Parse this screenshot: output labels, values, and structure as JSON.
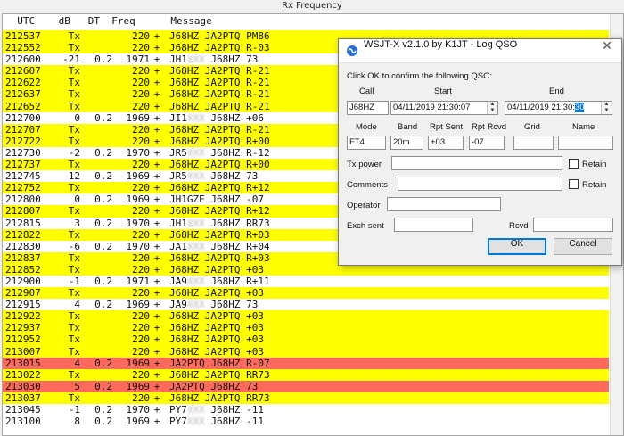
{
  "window": {
    "title": "Rx Frequency"
  },
  "columns": {
    "header": "  UTC    dB   DT  Freq      Message"
  },
  "rows": [
    {
      "utc": "212537",
      "db": "Tx",
      "dt": "",
      "freq": "220",
      "pl": "+",
      "msg": "J68HZ JA2PTQ PM86",
      "style": "tx"
    },
    {
      "utc": "212552",
      "db": "Tx",
      "dt": "",
      "freq": "220",
      "pl": "+",
      "msg": "J68HZ JA2PTQ R-03",
      "style": "tx"
    },
    {
      "utc": "212600",
      "db": "-21",
      "dt": "0.2",
      "freq": "1971",
      "pl": "+",
      "msg_pre": "JH1",
      "msg_blur": "XXX",
      "msg_post": " J68HZ 73",
      "style": ""
    },
    {
      "utc": "212607",
      "db": "Tx",
      "dt": "",
      "freq": "220",
      "pl": "+",
      "msg": "J68HZ JA2PTQ R-21",
      "style": "tx"
    },
    {
      "utc": "212622",
      "db": "Tx",
      "dt": "",
      "freq": "220",
      "pl": "+",
      "msg": "J68HZ JA2PTQ R-21",
      "style": "tx"
    },
    {
      "utc": "212637",
      "db": "Tx",
      "dt": "",
      "freq": "220",
      "pl": "+",
      "msg": "J68HZ JA2PTQ R-21",
      "style": "tx"
    },
    {
      "utc": "212652",
      "db": "Tx",
      "dt": "",
      "freq": "220",
      "pl": "+",
      "msg": "J68HZ JA2PTQ R-21",
      "style": "tx"
    },
    {
      "utc": "212700",
      "db": "0",
      "dt": "0.2",
      "freq": "1969",
      "pl": "+",
      "msg_pre": "JI1",
      "msg_blur": "XXX",
      "msg_post": " J68HZ +06",
      "style": ""
    },
    {
      "utc": "212707",
      "db": "Tx",
      "dt": "",
      "freq": "220",
      "pl": "+",
      "msg": "J68HZ JA2PTQ R-21",
      "style": "tx"
    },
    {
      "utc": "212722",
      "db": "Tx",
      "dt": "",
      "freq": "220",
      "pl": "+",
      "msg": "J68HZ JA2PTQ R+00",
      "style": "tx"
    },
    {
      "utc": "212730",
      "db": "-2",
      "dt": "0.2",
      "freq": "1970",
      "pl": "+",
      "msg_pre": "JR5",
      "msg_blur": "XXX",
      "msg_post": " J68HZ R-12",
      "style": ""
    },
    {
      "utc": "212737",
      "db": "Tx",
      "dt": "",
      "freq": "220",
      "pl": "+",
      "msg": "J68HZ JA2PTQ R+00",
      "style": "tx"
    },
    {
      "utc": "212745",
      "db": "12",
      "dt": "0.2",
      "freq": "1969",
      "pl": "+",
      "msg_pre": "JR5",
      "msg_blur": "XXX",
      "msg_post": " J68HZ 73",
      "style": ""
    },
    {
      "utc": "212752",
      "db": "Tx",
      "dt": "",
      "freq": "220",
      "pl": "+",
      "msg": "J68HZ JA2PTQ R+12",
      "style": "tx"
    },
    {
      "utc": "212800",
      "db": "0",
      "dt": "0.2",
      "freq": "1969",
      "pl": "+",
      "msg": "JH1GZE J68HZ -07",
      "style": ""
    },
    {
      "utc": "212807",
      "db": "Tx",
      "dt": "",
      "freq": "220",
      "pl": "+",
      "msg": "J68HZ JA2PTQ R+12",
      "style": "tx"
    },
    {
      "utc": "212815",
      "db": "3",
      "dt": "0.2",
      "freq": "1970",
      "pl": "+",
      "msg_pre": "JH1",
      "msg_blur": "XXX",
      "msg_post": " J68HZ RR73",
      "style": ""
    },
    {
      "utc": "212822",
      "db": "Tx",
      "dt": "",
      "freq": "220",
      "pl": "+",
      "msg": "J68HZ JA2PTQ R+03",
      "style": "tx"
    },
    {
      "utc": "212830",
      "db": "-6",
      "dt": "0.2",
      "freq": "1970",
      "pl": "+",
      "msg_pre": "JA1",
      "msg_blur": "XXX",
      "msg_post": " J68HZ R+04",
      "style": ""
    },
    {
      "utc": "212837",
      "db": "Tx",
      "dt": "",
      "freq": "220",
      "pl": "+",
      "msg": "J68HZ JA2PTQ R+03",
      "style": "tx"
    },
    {
      "utc": "212852",
      "db": "Tx",
      "dt": "",
      "freq": "220",
      "pl": "+",
      "msg": "J68HZ JA2PTQ +03",
      "style": "tx"
    },
    {
      "utc": "212900",
      "db": "-1",
      "dt": "0.2",
      "freq": "1971",
      "pl": "+",
      "msg_pre": "JA9",
      "msg_blur": "XXX",
      "msg_post": " J68HZ R+11",
      "style": ""
    },
    {
      "utc": "212907",
      "db": "Tx",
      "dt": "",
      "freq": "220",
      "pl": "+",
      "msg": "J68HZ JA2PTQ +03",
      "style": "tx"
    },
    {
      "utc": "212915",
      "db": "4",
      "dt": "0.2",
      "freq": "1969",
      "pl": "+",
      "msg_pre": "JA9",
      "msg_blur": "XXX",
      "msg_post": " J68HZ 73",
      "style": ""
    },
    {
      "utc": "212922",
      "db": "Tx",
      "dt": "",
      "freq": "220",
      "pl": "+",
      "msg": "J68HZ JA2PTQ +03",
      "style": "tx"
    },
    {
      "utc": "212937",
      "db": "Tx",
      "dt": "",
      "freq": "220",
      "pl": "+",
      "msg": "J68HZ JA2PTQ +03",
      "style": "tx"
    },
    {
      "utc": "212952",
      "db": "Tx",
      "dt": "",
      "freq": "220",
      "pl": "+",
      "msg": "J68HZ JA2PTQ +03",
      "style": "tx"
    },
    {
      "utc": "213007",
      "db": "Tx",
      "dt": "",
      "freq": "220",
      "pl": "+",
      "msg": "J68HZ JA2PTQ +03",
      "style": "tx"
    },
    {
      "utc": "213015",
      "db": "4",
      "dt": "0.2",
      "freq": "1969",
      "pl": "+",
      "msg": "JA2PTQ J68HZ R-07",
      "style": "hl"
    },
    {
      "utc": "213022",
      "db": "Tx",
      "dt": "",
      "freq": "220",
      "pl": "+",
      "msg": "J68HZ JA2PTQ RR73",
      "style": "tx"
    },
    {
      "utc": "213030",
      "db": "5",
      "dt": "0.2",
      "freq": "1969",
      "pl": "+",
      "msg": "JA2PTQ J68HZ 73",
      "style": "hl"
    },
    {
      "utc": "213037",
      "db": "Tx",
      "dt": "",
      "freq": "220",
      "pl": "+",
      "msg": "J68HZ JA2PTQ RR73",
      "style": "tx"
    },
    {
      "utc": "213045",
      "db": "-1",
      "dt": "0.2",
      "freq": "1970",
      "pl": "+",
      "msg_pre": "PY7",
      "msg_blur": "XXX",
      "msg_post": " J68HZ -11",
      "style": ""
    },
    {
      "utc": "213100",
      "db": "8",
      "dt": "0.2",
      "freq": "1969",
      "pl": "+",
      "msg_pre": "PY7",
      "msg_blur": "XXX",
      "msg_post": " J68HZ -11",
      "style": ""
    }
  ],
  "colors": {
    "tx": "#ffff00",
    "highlight": "#ff6a5c",
    "accent": "#0078d7"
  },
  "dialog": {
    "icon": "wsjtx-logo-icon",
    "title": "WSJT-X   v2.1.0   by K1JT - Log QSO",
    "close": "✕",
    "prompt": "Click OK to confirm the following QSO:",
    "labels": {
      "call": "Call",
      "start": "Start",
      "end": "End",
      "mode": "Mode",
      "band": "Band",
      "rpt_sent": "Rpt Sent",
      "rpt_rcvd": "Rpt Rcvd",
      "grid": "Grid",
      "name": "Name",
      "tx_power": "Tx power",
      "comments": "Comments",
      "operator": "Operator",
      "exch_sent": "Exch sent",
      "rcvd": "Rcvd",
      "retain": "Retain"
    },
    "values": {
      "call": "J68HZ",
      "start": "04/11/2019 21:30:07",
      "end_main": "04/11/2019 21:30:",
      "end_sel": "30",
      "mode": "FT4",
      "band": "20m",
      "rpt_sent": "+03",
      "rpt_rcvd": "-07",
      "grid": "",
      "name": "",
      "tx_power": "",
      "comments": "",
      "operator": "",
      "exch_sent": "",
      "rcvd": ""
    },
    "buttons": {
      "ok": "OK",
      "cancel": "Cancel"
    }
  }
}
